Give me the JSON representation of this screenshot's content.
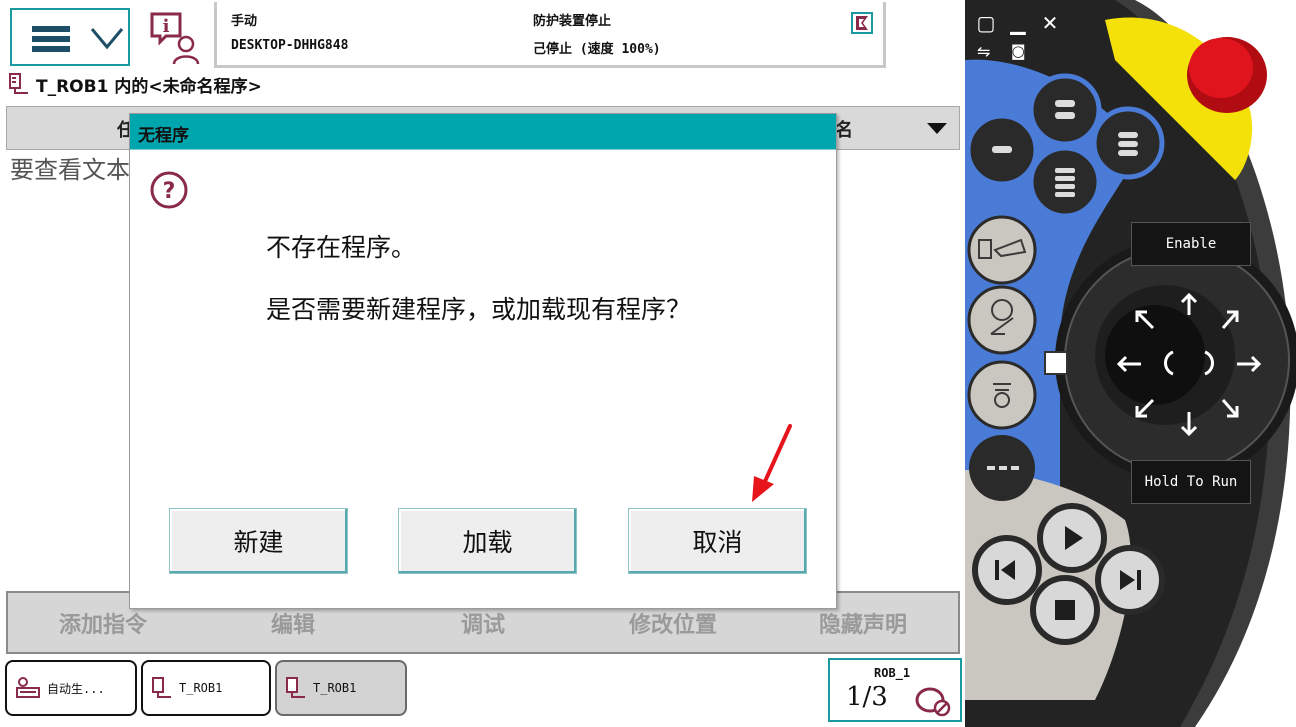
{
  "status": {
    "mode": "手动",
    "host": "DESKTOP-DHHG848",
    "guard_state": "防护装置停止",
    "run_state": "己停止 (速度 100%)"
  },
  "breadcrumb": "T_ROB1 内的<未命名程序>",
  "tab_row": {
    "left_fragment": "任",
    "right_fragment": "名"
  },
  "hint_text": "要查看文本",
  "dialog": {
    "title": "无程序",
    "message_1": "不存在程序。",
    "message_2": "是否需要新建程序，或加载现有程序？",
    "buttons": {
      "new": "新建",
      "load": "加载",
      "cancel": "取消"
    }
  },
  "command_bar": [
    "添加指令",
    "编辑",
    "调试",
    "修改位置",
    "隐藏声明"
  ],
  "taskbar": {
    "tasks": [
      "自动生...",
      "T_ROB1",
      "T_ROB1"
    ],
    "quickset_label": "ROB_1",
    "quickset_fraction": "1/3"
  },
  "pendant": {
    "enable_label": "Enable",
    "hold_to_run_label": "Hold To Run"
  },
  "colors": {
    "accent": "#00a6ad",
    "pendant_blue": "#4a7bd6",
    "pendant_yellow": "#f4e10a",
    "emergency_red": "#e0141c",
    "arrow_red": "#e8141c",
    "info_icon": "#8a2a4a"
  },
  "icons": [
    "menu-icon",
    "info-icon",
    "program-icon",
    "question-icon",
    "warning-flag-icon",
    "hold-run-icon"
  ]
}
